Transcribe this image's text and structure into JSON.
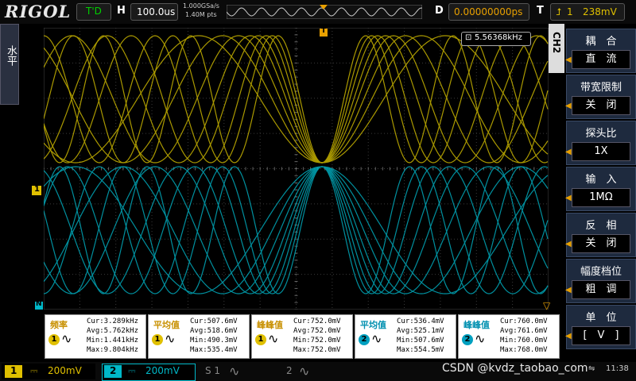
{
  "topbar": {
    "brand": "RIGOL",
    "trigger_status": "T'D",
    "timebase_label": "H",
    "timebase_value": "100.0us",
    "sample_rate": "1.000GSa/s",
    "memory_depth": "1.40M pts",
    "delay_label": "D",
    "delay_value": "0.00000000ps",
    "trigger_label": "T",
    "trigger_channel": "1",
    "trigger_level": "238mV"
  },
  "left_tab": {
    "label": "水平"
  },
  "screen": {
    "freq_readout": "5.56368kHz",
    "ch1_marker": "1",
    "ch2_marker": "N"
  },
  "right_menu": {
    "channel": "CH2",
    "items": [
      {
        "title": "耦　合",
        "value": "直　流"
      },
      {
        "title": "带宽限制",
        "value": "关　闭"
      },
      {
        "title": "探头比",
        "value": "1X"
      },
      {
        "title": "输　入",
        "value": "1MΩ"
      },
      {
        "title": "反　相",
        "value": "关　闭"
      },
      {
        "title": "幅度档位",
        "value": "粗　调"
      },
      {
        "title": "单　位",
        "value": "[　V　]"
      }
    ]
  },
  "measurements": [
    {
      "name": "频率",
      "channel": "1",
      "cur": "Cur:3.289kHz",
      "avg": "Avg:5.762kHz",
      "min": "Min:1.441kHz",
      "max": "Max:9.804kHz",
      "color": "#e0c000"
    },
    {
      "name": "平均值",
      "channel": "1",
      "cur": "Cur:507.6mV",
      "avg": "Avg:518.6mV",
      "min": "Min:490.3mV",
      "max": "Max:535.4mV",
      "color": "#e0c000"
    },
    {
      "name": "峰峰值",
      "channel": "1",
      "cur": "Cur:752.0mV",
      "avg": "Avg:752.0mV",
      "min": "Min:752.0mV",
      "max": "Max:752.0mV",
      "color": "#e0c000"
    },
    {
      "name": "平均值",
      "channel": "2",
      "cur": "Cur:536.4mV",
      "avg": "Avg:525.1mV",
      "min": "Min:507.6mV",
      "max": "Max:554.5mV",
      "color": "#00a0c0"
    },
    {
      "name": "峰峰值",
      "channel": "2",
      "cur": "Cur:760.0mV",
      "avg": "Avg:761.6mV",
      "min": "Min:760.0mV",
      "max": "Max:768.0mV",
      "color": "#00a0c0"
    }
  ],
  "bottombar": {
    "ch1_num": "1",
    "ch1_scale": "200mV",
    "ch2_num": "2",
    "ch2_scale": "200mV",
    "s1": "S 1",
    "s2": "2",
    "watermark": "CSDN @kvdz_taobao_com",
    "time": "11:38"
  },
  "colors": {
    "ch1": "#d4c000",
    "ch2": "#00b8c8",
    "accent": "#e8a000"
  }
}
